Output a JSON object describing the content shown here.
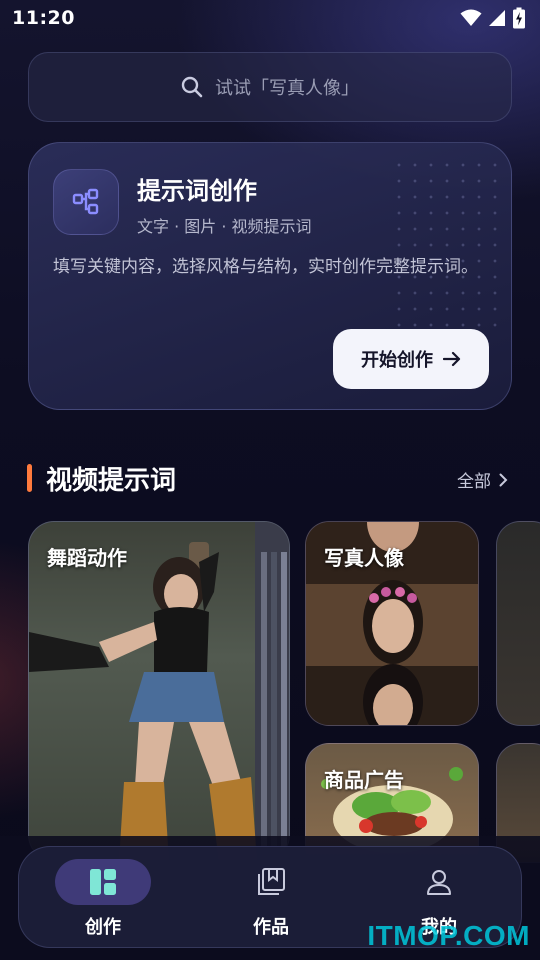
{
  "status_bar": {
    "time": "11:20"
  },
  "search": {
    "placeholder": "试试「写真人像」"
  },
  "prompt_card": {
    "title": "提示词创作",
    "subtitle": "文字 · 图片 · 视频提示词",
    "description": "填写关键内容，选择风格与结构，实时创作完整提示词。",
    "button_label": "开始创作"
  },
  "section": {
    "title": "视频提示词",
    "more_label": "全部"
  },
  "categories": [
    {
      "label": "舞蹈动作"
    },
    {
      "label": "写真人像"
    },
    {
      "label": "商品广告"
    }
  ],
  "bottom_nav": {
    "items": [
      {
        "label": "创作",
        "icon": "dashboard-icon",
        "active": true
      },
      {
        "label": "作品",
        "icon": "gallery-icon",
        "active": false
      },
      {
        "label": "我的",
        "icon": "profile-icon",
        "active": false
      }
    ]
  },
  "watermark": "ITMOP.COM",
  "colors": {
    "accent_orange": "#ff7a3d",
    "nav_active_bg": "#3f3a78",
    "icon_purple": "#8b8dff",
    "icon_teal": "#7fe6d6"
  }
}
